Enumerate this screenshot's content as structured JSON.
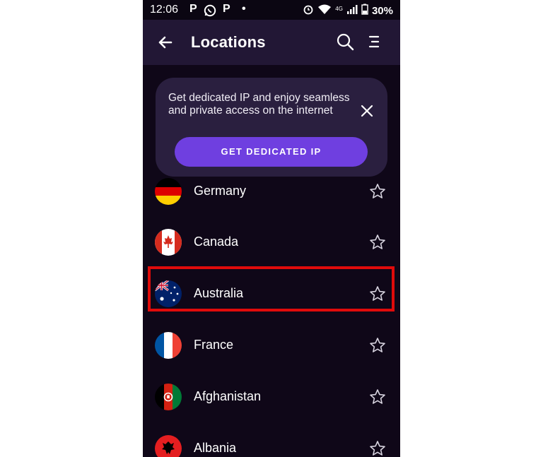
{
  "status_bar": {
    "time": "12:06",
    "left_icons": [
      "P",
      "whatsapp-icon",
      "P",
      "•"
    ],
    "network": "4G",
    "battery": "30%"
  },
  "app_bar": {
    "title": "Locations",
    "icons": [
      "back-arrow-icon",
      "search-icon",
      "menu-icon"
    ]
  },
  "banner": {
    "text": "Get dedicated IP and enjoy seamless and private access on the internet",
    "cta": "GET DEDICATED IP"
  },
  "locations": [
    {
      "name": "Germany",
      "flag": "germany-flag-icon"
    },
    {
      "name": "Canada",
      "flag": "canada-flag-icon"
    },
    {
      "name": "Australia",
      "flag": "australia-flag-icon",
      "highlighted": true
    },
    {
      "name": "France",
      "flag": "france-flag-icon"
    },
    {
      "name": "Afghanistan",
      "flag": "afghanistan-flag-icon"
    },
    {
      "name": "Albania",
      "flag": "albania-flag-icon"
    }
  ],
  "colors": {
    "background": "#0f0718",
    "app_bar": "#221735",
    "banner": "#2a1f3f",
    "button": "#6f3fe0",
    "highlight_box": "#e00b0b"
  }
}
